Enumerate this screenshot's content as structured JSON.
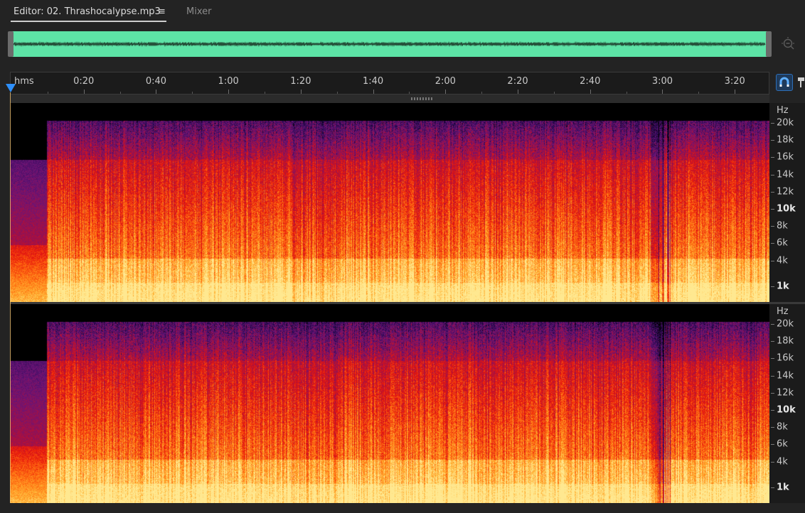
{
  "tabs": {
    "editor_label": "Editor: 02. Thrashocalypse.mp3",
    "menu_icon": "hamburger-menu-icon",
    "mixer_label": "Mixer"
  },
  "overview": {
    "color": "#5de3a6",
    "zoom_icon": "zoom-magnifier-icon"
  },
  "ruler": {
    "unit": "hms",
    "ticks": [
      {
        "label": "0:20",
        "seconds": 20
      },
      {
        "label": "0:40",
        "seconds": 40
      },
      {
        "label": "1:00",
        "seconds": 60
      },
      {
        "label": "1:20",
        "seconds": 80
      },
      {
        "label": "1:40",
        "seconds": 100
      },
      {
        "label": "2:00",
        "seconds": 120
      },
      {
        "label": "2:20",
        "seconds": 140
      },
      {
        "label": "2:40",
        "seconds": 160
      },
      {
        "label": "3:00",
        "seconds": 180
      },
      {
        "label": "3:20",
        "seconds": 200
      }
    ],
    "snap_icon": "snap-magnet-icon",
    "marker_icon": "marker-pin-icon"
  },
  "playhead": {
    "seconds": 0,
    "color": "#2e8ffa"
  },
  "spectral": {
    "freq_unit": "Hz",
    "freq_labels": [
      {
        "label": "20k",
        "hz": 20000,
        "bold": false
      },
      {
        "label": "18k",
        "hz": 18000,
        "bold": false
      },
      {
        "label": "16k",
        "hz": 16000,
        "bold": false
      },
      {
        "label": "14k",
        "hz": 14000,
        "bold": false
      },
      {
        "label": "12k",
        "hz": 12000,
        "bold": false
      },
      {
        "label": "10k",
        "hz": 10000,
        "bold": true
      },
      {
        "label": "8k",
        "hz": 8000,
        "bold": false
      },
      {
        "label": "6k",
        "hz": 6000,
        "bold": false
      },
      {
        "label": "4k",
        "hz": 4000,
        "bold": false
      },
      {
        "label": "1k",
        "hz": 1000,
        "bold": true
      }
    ],
    "palette": [
      "#000000",
      "#2a0a55",
      "#6a1477",
      "#b0103a",
      "#e8180c",
      "#ff6a10",
      "#ffb030",
      "#ffe890"
    ]
  }
}
